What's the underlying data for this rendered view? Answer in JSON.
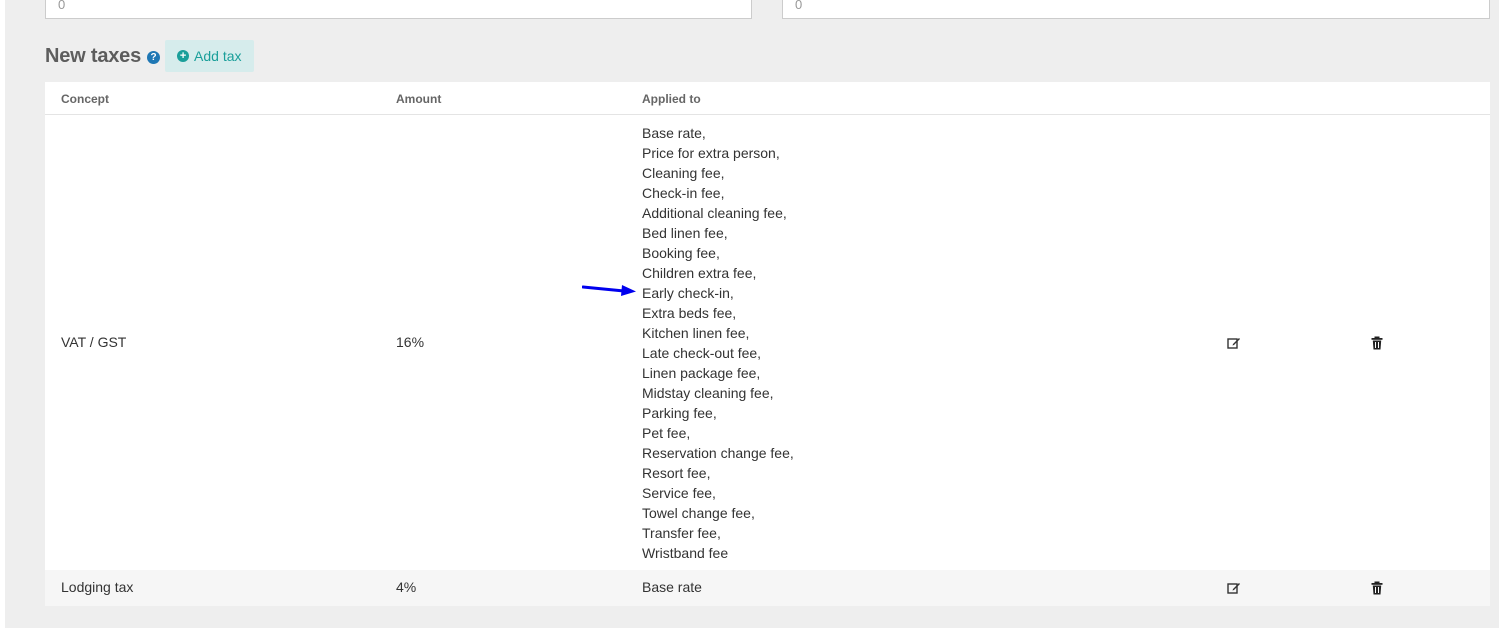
{
  "top_fields": {
    "left_value": "0",
    "right_value": "0"
  },
  "section": {
    "title": "New taxes",
    "help_glyph": "?",
    "add_button_label": "Add tax"
  },
  "table": {
    "headers": {
      "concept": "Concept",
      "amount": "Amount",
      "applied_to": "Applied to"
    },
    "rows": [
      {
        "concept": "VAT / GST",
        "amount": "16%",
        "applied_to": [
          "Base rate,",
          "Price for extra person,",
          "Cleaning fee,",
          "Check-in fee,",
          "Additional cleaning fee,",
          "Bed linen fee,",
          "Booking fee,",
          "Children extra fee,",
          "Early check-in,",
          "Extra beds fee,",
          "Kitchen linen fee,",
          "Late check-out fee,",
          "Linen package fee,",
          "Midstay cleaning fee,",
          "Parking fee,",
          "Pet fee,",
          "Reservation change fee,",
          "Resort fee,",
          "Service fee,",
          "Towel change fee,",
          "Transfer fee,",
          "Wristband fee"
        ]
      },
      {
        "concept": "Lodging tax",
        "amount": "4%",
        "applied_to": "Base rate"
      }
    ]
  },
  "colors": {
    "panel_bg": "#eeeeee",
    "accent_teal": "#1a9f9a",
    "add_button_bg": "#d6ecec",
    "help_blue": "#1f77b4",
    "annotation_arrow": "#0000ee"
  },
  "icons": {
    "help": "question-circle-icon",
    "add": "plus-circle-icon",
    "edit": "edit-icon",
    "delete": "trash-icon",
    "annotation": "arrow-right-icon"
  }
}
